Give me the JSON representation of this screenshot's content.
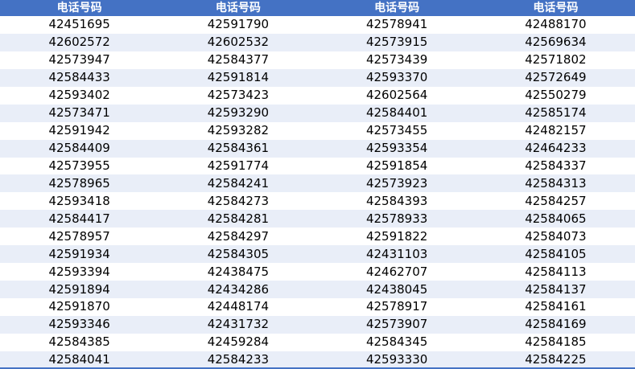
{
  "table": {
    "headers": [
      "电话号码",
      "电话号码",
      "电话号码",
      "电话号码"
    ],
    "rows": [
      [
        "42451695",
        "42591790",
        "42578941",
        "42488170"
      ],
      [
        "42602572",
        "42602532",
        "42573915",
        "42569634"
      ],
      [
        "42573947",
        "42584377",
        "42573439",
        "42571802"
      ],
      [
        "42584433",
        "42591814",
        "42593370",
        "42572649"
      ],
      [
        "42593402",
        "42573423",
        "42602564",
        "42550279"
      ],
      [
        "42573471",
        "42593290",
        "42584401",
        "42585174"
      ],
      [
        "42591942",
        "42593282",
        "42573455",
        "42482157"
      ],
      [
        "42584409",
        "42584361",
        "42593354",
        "42464233"
      ],
      [
        "42573955",
        "42591774",
        "42591854",
        "42584337"
      ],
      [
        "42578965",
        "42584241",
        "42573923",
        "42584313"
      ],
      [
        "42593418",
        "42584273",
        "42584393",
        "42584257"
      ],
      [
        "42584417",
        "42584281",
        "42578933",
        "42584065"
      ],
      [
        "42578957",
        "42584297",
        "42591822",
        "42584073"
      ],
      [
        "42591934",
        "42584305",
        "42431103",
        "42584105"
      ],
      [
        "42593394",
        "42438475",
        "42462707",
        "42584113"
      ],
      [
        "42591894",
        "42434286",
        "42438045",
        "42584137"
      ],
      [
        "42591870",
        "42448174",
        "42578917",
        "42584161"
      ],
      [
        "42593346",
        "42431732",
        "42573907",
        "42584169"
      ],
      [
        "42584385",
        "42459284",
        "42584345",
        "42584185"
      ],
      [
        "42584041",
        "42584233",
        "42593330",
        "42584225"
      ]
    ]
  },
  "colors": {
    "header_bg": "#4472c4",
    "header_text": "#ffffff",
    "band_row": "#e9eef8"
  }
}
